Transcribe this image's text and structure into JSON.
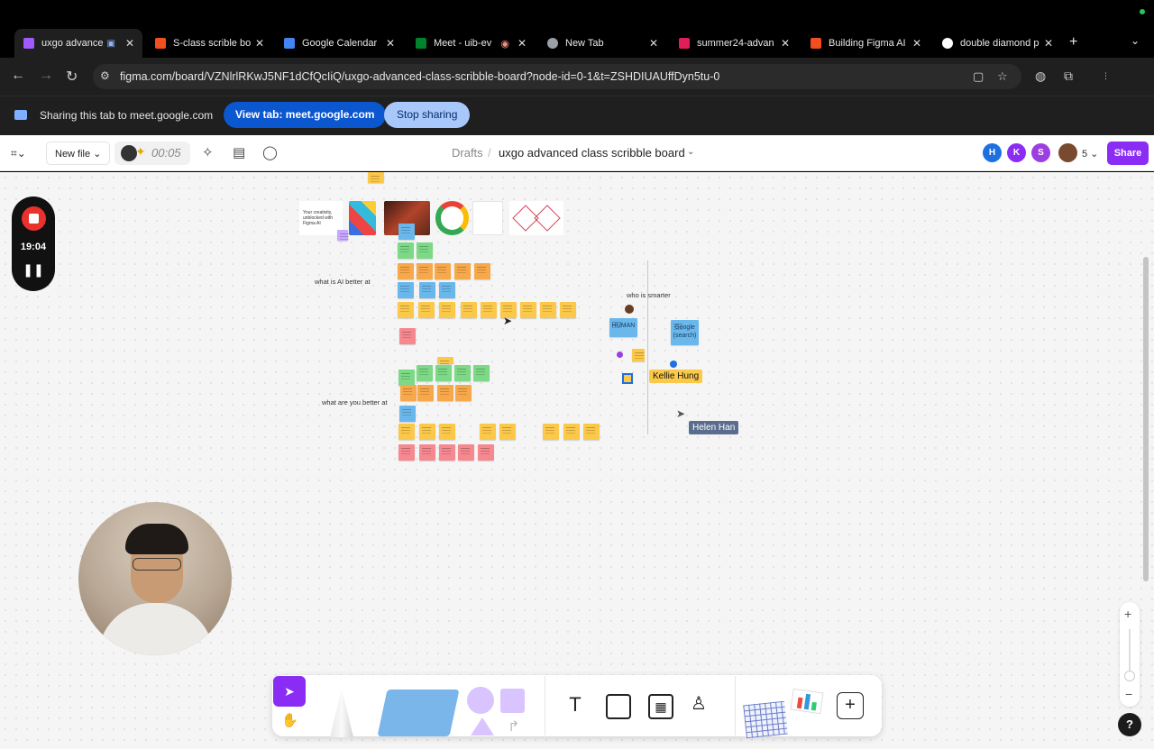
{
  "browser": {
    "tabs": [
      {
        "label": "uxgo advance",
        "favicon_color": "#a259ff"
      },
      {
        "label": "S-class scrible bo",
        "favicon_color": "#f24e1e"
      },
      {
        "label": "Google Calendar",
        "favicon_color": "#4285f4"
      },
      {
        "label": "Meet - uib-ev",
        "favicon_color": "#00832d"
      },
      {
        "label": "New Tab",
        "favicon_color": "#9aa0a6"
      },
      {
        "label": "summer24-advan",
        "favicon_color": "#e01e5a"
      },
      {
        "label": "Building Figma AI",
        "favicon_color": "#f24e1e"
      },
      {
        "label": "double diamond p",
        "favicon_color": "#ffffff"
      }
    ],
    "url": "figma.com/board/VZNlrlRKwJ5NF1dCfQcIiQ/uxgo-advanced-class-scribble-board?node-id=0-1&t=ZSHDIUAUffDyn5tu-0",
    "share_bar": {
      "message": "Sharing this tab to meet.google.com",
      "view_tab": "View tab: meet.google.com",
      "stop_sharing": "Stop sharing"
    }
  },
  "figma": {
    "new_file": "New file",
    "timer": "00:05",
    "breadcrumb": {
      "drafts": "Drafts",
      "separator": "/",
      "title": "uxgo advanced class scribble board"
    },
    "avatars": [
      {
        "initial": "H",
        "color": "#1e6fe0"
      },
      {
        "initial": "K",
        "color": "#8b2cf5"
      },
      {
        "initial": "S",
        "color": "#9b3fe0"
      }
    ],
    "avatar_count": "5",
    "share": "Share"
  },
  "board": {
    "labels": {
      "ai_better": "what is AI better at",
      "you_better": "what are you better at",
      "who_smarter": "who is smarter",
      "human": "HUMAN",
      "google": "Google (search)"
    },
    "thumb_caption": "Your creativity, unblocked with Figma AI",
    "cursors": {
      "kellie": "Kellie Hung",
      "helen": "Helen Han"
    }
  },
  "recording": {
    "time": "19:04"
  },
  "tools": {
    "text_glyph": "T"
  },
  "help": "?"
}
